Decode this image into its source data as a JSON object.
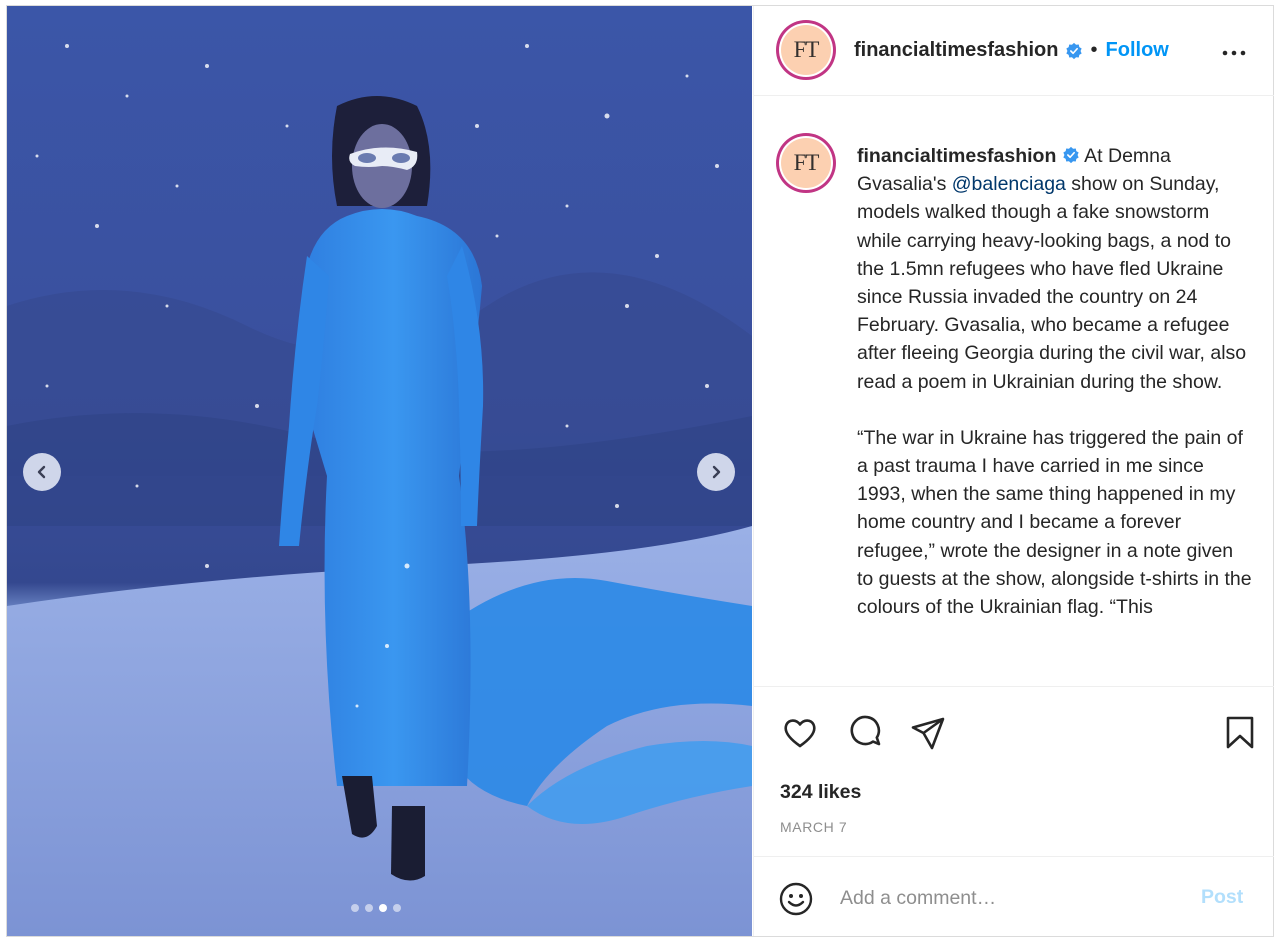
{
  "post": {
    "username": "financialtimesfashion",
    "avatar_text": "FT",
    "follow_label": "Follow",
    "separator": "•",
    "caption": {
      "lines_1": "At Demna Gvasalia's ",
      "mention": "@balenciaga",
      "lines_2": " show on Sunday, models walked though a fake snowstorm while carrying heavy-looking bags, a nod to the 1.5mn refugees who have fled Ukraine since Russia invaded the country on 24 February. Gvasalia, who became a refugee after fleeing Georgia during the civil war, also read a poem in Ukrainian during the show.",
      "paragraph_2": "“The war in Ukraine has triggered the pain of a past trauma I have carried in me since 1993, when the same thing happened in my home country and I became a forever refugee,” wrote the designer in a note given to guests at the show, alongside t-shirts in the colours of the Ukrainian flag. “This"
    },
    "likes": "324 likes",
    "date": "MARCH 7"
  },
  "comment": {
    "placeholder": "Add a comment…",
    "post_label": "Post"
  },
  "carousel": {
    "slides": 4,
    "active": 3
  },
  "icons": {
    "prev": "chevron-left-icon",
    "next": "chevron-right-icon",
    "more": "more-horizontal-icon",
    "verified": "verified-badge-icon",
    "like": "heart-icon",
    "comment": "comment-icon",
    "share": "send-icon",
    "save": "bookmark-icon",
    "emoji": "emoji-icon"
  },
  "colors": {
    "accent": "#0095f6",
    "post_disabled": "#b2dffc",
    "verified": "#3897f0",
    "avatar_bg": "#fcd0b1",
    "avatar_ring": "#c13584"
  }
}
